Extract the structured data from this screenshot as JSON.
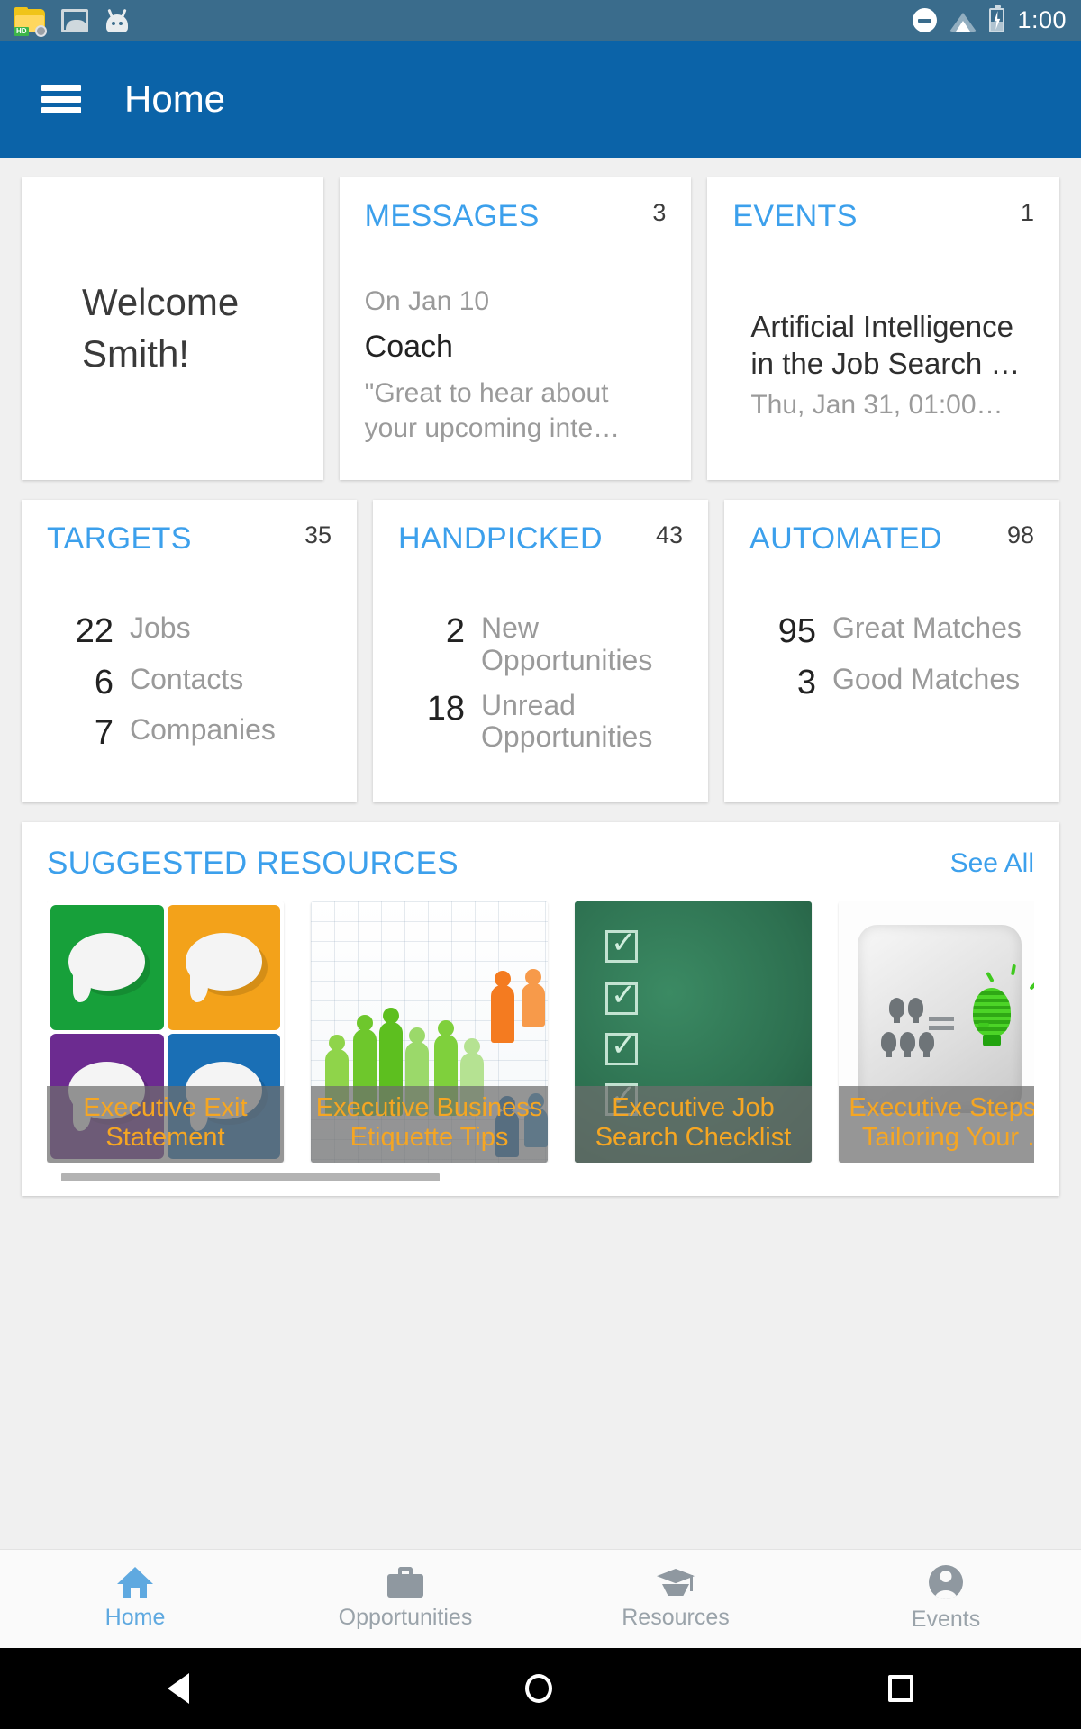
{
  "status_bar": {
    "time": "1:00",
    "left_icons": [
      "file-manager-icon",
      "gallery-icon",
      "cyanogenmod-robot-icon"
    ],
    "right_icons": [
      "do-not-disturb-icon",
      "wifi-icon",
      "battery-charging-icon"
    ]
  },
  "app_bar": {
    "menu_icon": "hamburger-menu-icon",
    "title": "Home"
  },
  "welcome": {
    "line1": "Welcome",
    "line2": "Smith!"
  },
  "messages": {
    "title": "MESSAGES",
    "count": "3",
    "date": "On Jan 10",
    "sender": "Coach",
    "snippet": "\"Great to hear about your upcoming inte…"
  },
  "events": {
    "title": "EVENTS",
    "count": "1",
    "event_title": "Artificial Intelligence in the Job Search …",
    "event_date": "Thu, Jan 31, 01:00…"
  },
  "targets": {
    "title": "TARGETS",
    "count": "35",
    "stats": [
      {
        "value": "22",
        "label": "Jobs"
      },
      {
        "value": "6",
        "label": "Contacts"
      },
      {
        "value": "7",
        "label": "Companies"
      }
    ]
  },
  "handpicked": {
    "title": "HANDPICKED",
    "count": "43",
    "stats": [
      {
        "value": "2",
        "label": "New Opportunities"
      },
      {
        "value": "18",
        "label": "Unread Opportunities"
      }
    ]
  },
  "automated": {
    "title": "AUTOMATED",
    "count": "98",
    "stats": [
      {
        "value": "95",
        "label": "Great Matches"
      },
      {
        "value": "3",
        "label": "Good Matches"
      }
    ]
  },
  "suggested_resources": {
    "title": "SUGGESTED RESOURCES",
    "see_all": "See All",
    "items": [
      {
        "caption": "Executive Exit Statement",
        "thumb": "speech-bubbles-thumbnail"
      },
      {
        "caption": "Executive Business Etiquette Tips",
        "thumb": "business-people-silhouettes-thumbnail"
      },
      {
        "caption": "Executive Job Search Checklist",
        "thumb": "chalkboard-checklist-thumbnail"
      },
      {
        "caption": "Executive Steps to Tailoring Your …",
        "thumb": "lightbulbs-thumbnail"
      }
    ]
  },
  "bottom_nav": {
    "items": [
      {
        "label": "Home",
        "icon": "home-icon",
        "active": true
      },
      {
        "label": "Opportunities",
        "icon": "briefcase-icon",
        "active": false
      },
      {
        "label": "Resources",
        "icon": "graduation-cap-icon",
        "active": false
      },
      {
        "label": "Events",
        "icon": "account-circle-icon",
        "active": false
      }
    ]
  },
  "android_nav": {
    "back": "back-button",
    "home": "home-button",
    "recents": "recents-button"
  },
  "colors": {
    "app_bar": "#0b63a8",
    "status_bar": "#3a6c8c",
    "accent": "#3ca0ec",
    "caption_text": "#f5a623"
  }
}
